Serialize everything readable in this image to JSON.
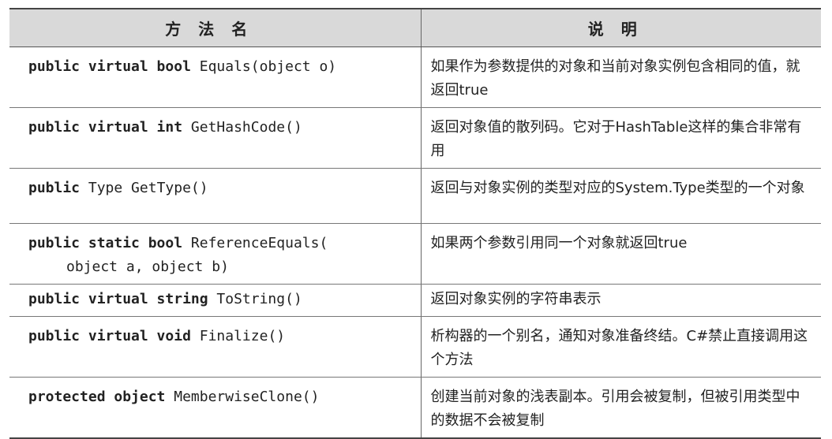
{
  "header": {
    "col_method": "方法名",
    "col_desc": "说明"
  },
  "rows": [
    {
      "sig": [
        "public virtual bool",
        " Equals(object o)"
      ],
      "desc": "如果作为参数提供的对象和当前对象实例包含相同的值，就返回true"
    },
    {
      "sig": [
        "public virtual int",
        " GetHashCode()"
      ],
      "desc": "返回对象值的散列码。它对于HashTable这样的集合非常有用"
    },
    {
      "sig": [
        "public",
        " Type GetType()"
      ],
      "desc": "返回与对象实例的类型对应的System.Type类型的一个对象"
    },
    {
      "sig": [
        "public static bool",
        " ReferenceEquals("
      ],
      "sig_cont": "object a, object b)",
      "desc": "如果两个参数引用同一个对象就返回true"
    },
    {
      "sig": [
        "public virtual string",
        " ToString()"
      ],
      "desc": "返回对象实例的字符串表示"
    },
    {
      "sig": [
        "public virtual void",
        " Finalize()"
      ],
      "desc": "析构器的一个别名，通知对象准备终结。C#禁止直接调用这个方法"
    },
    {
      "sig": [
        "protected object",
        " MemberwiseClone()"
      ],
      "desc": "创建当前对象的浅表副本。引用会被复制，但被引用类型中的数据不会被复制"
    }
  ]
}
